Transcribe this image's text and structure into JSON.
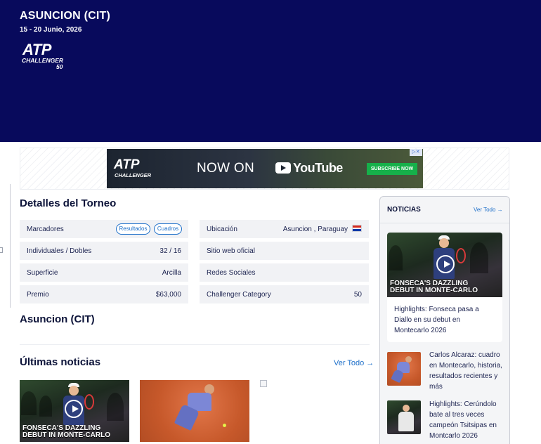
{
  "header": {
    "title": "ASUNCION (CIT)",
    "dates": "15 - 20 Junio, 2026",
    "logo": {
      "brand": "ATP",
      "series": "CHALLENGER",
      "level": "50"
    }
  },
  "ad": {
    "brand": "ATP",
    "brand_sub": "CHALLENGER",
    "headline": "NOW ON",
    "platform": "YouTube",
    "button": "SUBSCRIBE NOW"
  },
  "details": {
    "title": "Detalles del Torneo",
    "left": [
      {
        "label": "Marcadores",
        "buttons": [
          "Resultados",
          "Cuadros"
        ]
      },
      {
        "label": "Individuales / Dobles",
        "value": "32 / 16"
      },
      {
        "label": "Superficie",
        "value": "Arcilla"
      },
      {
        "label": "Premio",
        "value": "$63,000"
      }
    ],
    "right": [
      {
        "label": "Ubicación",
        "value": "Asuncion , Paraguay"
      },
      {
        "label": "Sitio web oficial",
        "value": ""
      },
      {
        "label": "Redes Sociales",
        "value": ""
      },
      {
        "label": "Challenger Category",
        "value": "50"
      }
    ]
  },
  "tournament_name": "Asuncion (CIT)",
  "news": {
    "title": "Últimas noticias",
    "see_all": "Ver Todo",
    "thumbs": [
      {
        "caption_line1": "FONSECA'S DAZZLING",
        "caption_line2": "DEBUT IN MONTE-CARLO"
      },
      {
        "caption_line1": "",
        "caption_line2": ""
      }
    ]
  },
  "sidebar": {
    "title": "NOTICIAS",
    "see_all": "Ver Todo",
    "featured": {
      "caption_line1": "FONSECA'S DAZZLING",
      "caption_line2": "DEBUT IN MONTE-CARLO",
      "text": "Highlights: Fonseca pasa a Diallo en su debut en Montecarlo 2026"
    },
    "items": [
      {
        "text": "Carlos Alcaraz: cuadro en Montecarlo, historia, resultados recientes y más"
      },
      {
        "text": "Highlights: Cerúndolo bate al tres veces campeón Tsitsipas en Montcarlo 2026"
      }
    ]
  },
  "colors": {
    "hero": "#080a5c",
    "accent": "#1d6fc9",
    "row": "#f1f2f5",
    "text": "#0b1238"
  },
  "icons": [
    "play-icon",
    "arrow-right-icon",
    "paraguay-flag-icon",
    "ad-choices-icon",
    "youtube-icon"
  ]
}
